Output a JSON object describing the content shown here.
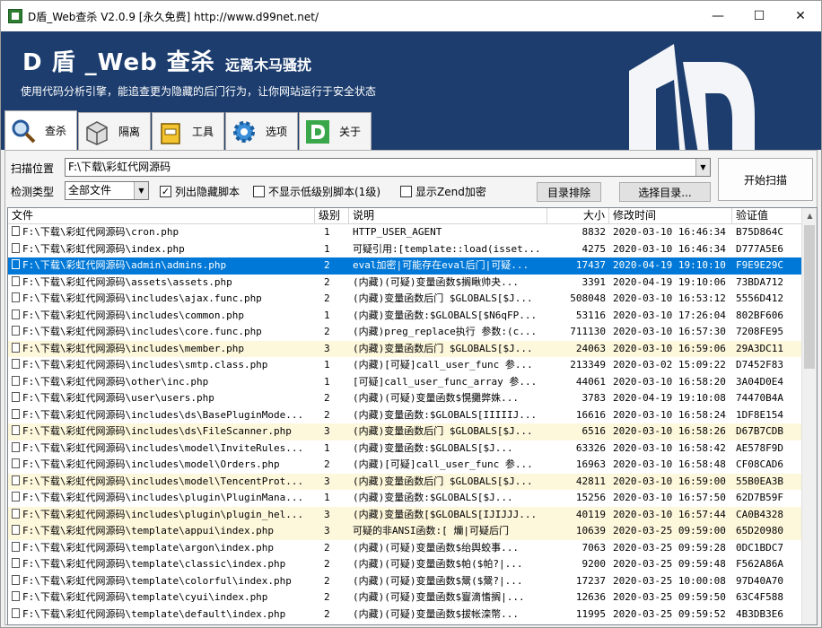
{
  "window": {
    "title": "D盾_Web查杀 V2.0.9 [永久免费] http://www.d99net.net/"
  },
  "banner": {
    "title": "D 盾 _Web 查杀",
    "subtitle": "远离木马骚扰",
    "description": "使用代码分析引擎，能追查更为隐藏的后门行为，让你网站运行于安全状态"
  },
  "tabs": [
    {
      "label": "查杀",
      "icon": "magnifier-icon",
      "active": true
    },
    {
      "label": "隔离",
      "icon": "box-icon"
    },
    {
      "label": "工具",
      "icon": "toolbox-icon"
    },
    {
      "label": "选项",
      "icon": "gear-icon"
    },
    {
      "label": "关于",
      "icon": "d-logo-icon"
    }
  ],
  "scan": {
    "location_label": "扫描位置",
    "location_value": "F:\\下载\\彩虹代网源码",
    "type_label": "检测类型",
    "type_value": "全部文件",
    "opt_hidden": "列出隐藏脚本",
    "opt_lowlevel": "不显示低级别脚本(1级)",
    "opt_zend": "显示Zend加密",
    "btn_exclude": "目录排除",
    "btn_select": "选择目录...",
    "btn_start": "开始扫描"
  },
  "columns": [
    "文件",
    "级别",
    "说明",
    "大小",
    "修改时间",
    "验证值"
  ],
  "rows": [
    {
      "file": "F:\\下载\\彩虹代网源码\\cron.php",
      "level": "1",
      "desc": "HTTP_USER_AGENT",
      "size": "8832",
      "time": "2020-03-10 16:46:34",
      "hash": "B75D864C",
      "style": ""
    },
    {
      "file": "F:\\下载\\彩虹代网源码\\index.php",
      "level": "1",
      "desc": "可疑引用:[template::load(isset...",
      "size": "4275",
      "time": "2020-03-10 16:46:34",
      "hash": "D777A5E6",
      "style": ""
    },
    {
      "file": "F:\\下载\\彩虹代网源码\\admin\\admins.php",
      "level": "2",
      "desc": "eval加密|可能存在eval后门|可疑...",
      "size": "17437",
      "time": "2020-04-19 19:10:10",
      "hash": "F9E9E29C",
      "style": "selected"
    },
    {
      "file": "F:\\下载\\彩虹代网源码\\assets\\assets.php",
      "level": "2",
      "desc": "(内藏)(可疑)变量函数$搁瞅帅夬...",
      "size": "3391",
      "time": "2020-04-19 19:10:06",
      "hash": "73BDA712",
      "style": ""
    },
    {
      "file": "F:\\下载\\彩虹代网源码\\includes\\ajax.func.php",
      "level": "2",
      "desc": "(内藏)变量函数后门 $GLOBALS[$J...",
      "size": "508048",
      "time": "2020-03-10 16:53:12",
      "hash": "5556D412",
      "style": ""
    },
    {
      "file": "F:\\下载\\彩虹代网源码\\includes\\common.php",
      "level": "1",
      "desc": "(内藏)变量函数:$GLOBALS[$N6qFP...",
      "size": "53116",
      "time": "2020-03-10 17:26:04",
      "hash": "802BF606",
      "style": ""
    },
    {
      "file": "F:\\下载\\彩虹代网源码\\includes\\core.func.php",
      "level": "2",
      "desc": "(内藏)preg_replace执行 参数:(c...",
      "size": "711130",
      "time": "2020-03-10 16:57:30",
      "hash": "7208FE95",
      "style": ""
    },
    {
      "file": "F:\\下载\\彩虹代网源码\\includes\\member.php",
      "level": "3",
      "desc": "(内藏)变量函数后门 $GLOBALS[$J...",
      "size": "24063",
      "time": "2020-03-10 16:59:06",
      "hash": "29A3DC11",
      "style": "yellow"
    },
    {
      "file": "F:\\下载\\彩虹代网源码\\includes\\smtp.class.php",
      "level": "1",
      "desc": "(内藏)[可疑]call_user_func 参...",
      "size": "213349",
      "time": "2020-03-02 15:09:22",
      "hash": "D7452F83",
      "style": ""
    },
    {
      "file": "F:\\下载\\彩虹代网源码\\other\\inc.php",
      "level": "1",
      "desc": "[可疑]call_user_func_array 参...",
      "size": "44061",
      "time": "2020-03-10 16:58:20",
      "hash": "3A04D0E4",
      "style": ""
    },
    {
      "file": "F:\\下载\\彩虹代网源码\\user\\users.php",
      "level": "2",
      "desc": "(内藏)(可疑)变量函数$愰攤㢢姝...",
      "size": "3783",
      "time": "2020-04-19 19:10:08",
      "hash": "74470B4A",
      "style": ""
    },
    {
      "file": "F:\\下载\\彩虹代网源码\\includes\\ds\\BasePluginMode...",
      "level": "2",
      "desc": "(内藏)变量函数:$GLOBALS[IIIIIJ...",
      "size": "16616",
      "time": "2020-03-10 16:58:24",
      "hash": "1DF8E154",
      "style": ""
    },
    {
      "file": "F:\\下载\\彩虹代网源码\\includes\\ds\\FileScanner.php",
      "level": "3",
      "desc": "(内藏)变量函数后门 $GLOBALS[$J...",
      "size": "6516",
      "time": "2020-03-10 16:58:26",
      "hash": "D67B7CDB",
      "style": "yellow"
    },
    {
      "file": "F:\\下载\\彩虹代网源码\\includes\\model\\InviteRules...",
      "level": "1",
      "desc": "(内藏)变量函数:$GLOBALS[$J...",
      "size": "63326",
      "time": "2020-03-10 16:58:42",
      "hash": "AE578F9D",
      "style": ""
    },
    {
      "file": "F:\\下载\\彩虹代网源码\\includes\\model\\Orders.php",
      "level": "2",
      "desc": "(内藏)[可疑]call_user_func 参...",
      "size": "16963",
      "time": "2020-03-10 16:58:48",
      "hash": "CF08CAD6",
      "style": ""
    },
    {
      "file": "F:\\下载\\彩虹代网源码\\includes\\model\\TencentProt...",
      "level": "3",
      "desc": "(内藏)变量函数后门 $GLOBALS[$J...",
      "size": "42811",
      "time": "2020-03-10 16:59:00",
      "hash": "55B0EA3B",
      "style": "yellow"
    },
    {
      "file": "F:\\下载\\彩虹代网源码\\includes\\plugin\\PluginMana...",
      "level": "1",
      "desc": "(内藏)变量函数:$GLOBALS[$J...",
      "size": "15256",
      "time": "2020-03-10 16:57:50",
      "hash": "62D7B59F",
      "style": ""
    },
    {
      "file": "F:\\下载\\彩虹代网源码\\includes\\plugin\\plugin_hel...",
      "level": "3",
      "desc": "(内藏)变量函数[$GLOBALS[IJIJJJ...",
      "size": "40119",
      "time": "2020-03-10 16:57:44",
      "hash": "CA0B4328",
      "style": "yellow"
    },
    {
      "file": "F:\\下载\\彩虹代网源码\\template\\appui\\index.php",
      "level": "3",
      "desc": "可疑的非ANSI函数:[ 爤|可疑后门",
      "size": "10639",
      "time": "2020-03-25 09:59:00",
      "hash": "65D20980",
      "style": "yellow"
    },
    {
      "file": "F:\\下载\\彩虹代网源码\\template\\argon\\index.php",
      "level": "2",
      "desc": "(内藏)(可疑)变量函数$绐舆蛟事...",
      "size": "7063",
      "time": "2020-03-25 09:59:28",
      "hash": "0DC1BDC7",
      "style": ""
    },
    {
      "file": "F:\\下载\\彩虹代网源码\\template\\classic\\index.php",
      "level": "2",
      "desc": "(内藏)(可疑)变量函数$帕($帕?|...",
      "size": "9200",
      "time": "2020-03-25 09:59:48",
      "hash": "F562A86A",
      "style": ""
    },
    {
      "file": "F:\\下载\\彩虹代网源码\\template\\colorful\\index.php",
      "level": "2",
      "desc": "(内藏)(可疑)变量函数$鬶($鬶?|...",
      "size": "17237",
      "time": "2020-03-25 10:00:08",
      "hash": "97D40A70",
      "style": ""
    },
    {
      "file": "F:\\下载\\彩虹代网源码\\template\\cyui\\index.php",
      "level": "2",
      "desc": "(内藏)(可疑)变量函数$寷滴愭搁|...",
      "size": "12636",
      "time": "2020-03-25 09:59:50",
      "hash": "63C4F588",
      "style": ""
    },
    {
      "file": "F:\\下载\\彩虹代网源码\\template\\default\\index.php",
      "level": "2",
      "desc": "(内藏)(可疑)变量函数$拔帐滦幣...",
      "size": "11995",
      "time": "2020-03-25 09:59:52",
      "hash": "4B3DB3E6",
      "style": ""
    }
  ]
}
